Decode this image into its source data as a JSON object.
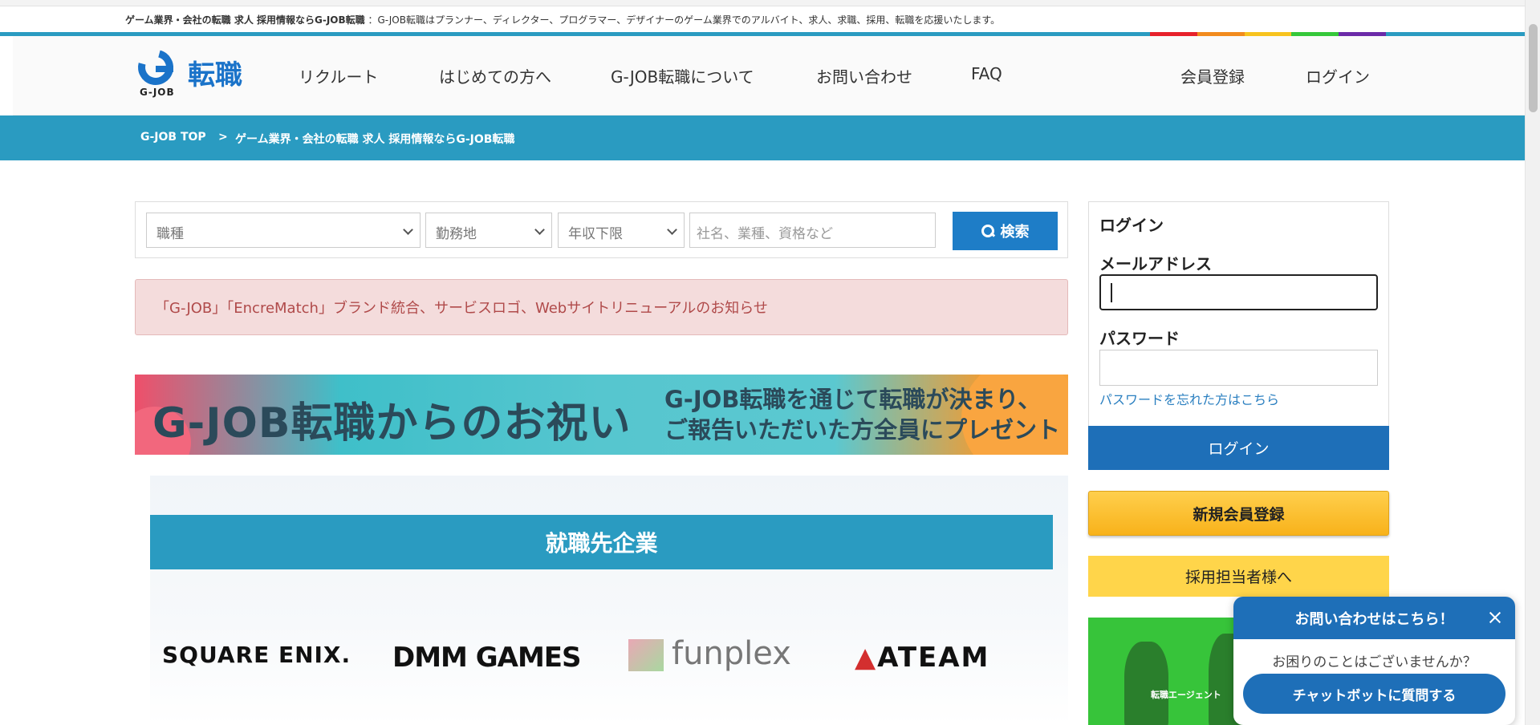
{
  "tagline": {
    "bold": "ゲーム業界・会社の転職 求人 採用情報ならG-JOB転職",
    "rest": "：G-JOB転職はプランナー、ディレクター、プログラマー、デザイナーのゲーム業界でのアルバイト、求人、求職、採用、転職を応援いたします。"
  },
  "brand": {
    "name": "転職",
    "sub": "G-JOB",
    "primary": "#1a73c9",
    "accent": "#2a9bc1"
  },
  "rainbow": [
    "#e7212b",
    "#f28b1d",
    "#f7c31e",
    "#35c83a",
    "#6b2aa8"
  ],
  "nav": {
    "items": [
      "リクルート",
      "はじめての方へ",
      "G-JOB転職について",
      "お問い合わせ",
      "FAQ"
    ],
    "register": "会員登録",
    "login": "ログイン"
  },
  "breadcrumb": {
    "home": "G-JOB TOP",
    "separator": ">",
    "current": "ゲーム業界・会社の転職 求人 採用情報ならG-JOB転職"
  },
  "search": {
    "job_type": "職種",
    "location": "勤務地",
    "salary": "年収下限",
    "keyword_placeholder": "社名、業種、資格など",
    "button": "検索"
  },
  "notice": "「G-JOB」「EncreMatch」ブランド統合、サービスロゴ、Webサイトリニューアルのお知らせ",
  "banner": {
    "left": "G-JOB転職からのお祝い",
    "right_line1": "G-JOB転職を通じて転職が決まり、",
    "right_line2": "ご報告いただいた方全員にプレゼント"
  },
  "companies": {
    "title": "就職先企業",
    "logos": [
      "SQUARE ENIX.",
      "DMM GAMES",
      "funplex",
      "ATEAM"
    ]
  },
  "login_box": {
    "title": "ログイン",
    "email_label": "メールアドレス",
    "password_label": "パスワード",
    "forgot": "パスワードを忘れた方はこちら",
    "button": "ログイン"
  },
  "sidebar": {
    "register": "新規会員登録",
    "recruiter": "採用担当者様へ",
    "video_caption": "転職エージェント"
  },
  "chat": {
    "title": "お問い合わせはこちら！",
    "question": "お困りのことはございませんか？",
    "button": "チャットボットに質問する"
  }
}
